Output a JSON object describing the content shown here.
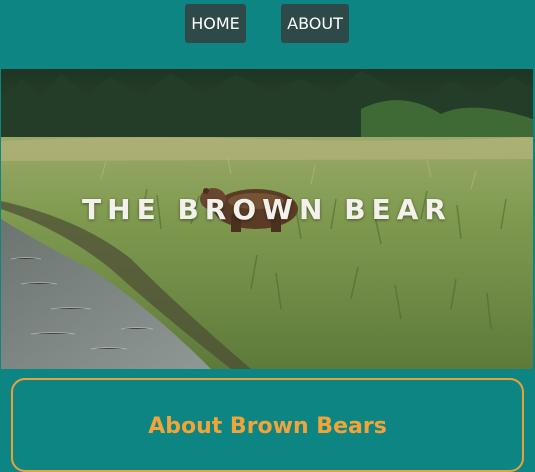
{
  "nav": {
    "home_label": "HOME",
    "about_label": "ABOUT"
  },
  "hero": {
    "title": "THE BROWN BEAR",
    "image_subject": "brown bear in tall grass meadow beside water"
  },
  "about": {
    "heading": "About Brown Bears"
  },
  "colors": {
    "page_background": "#0d8583",
    "nav_button": "#2e4a48",
    "accent": "#f0a43a"
  }
}
